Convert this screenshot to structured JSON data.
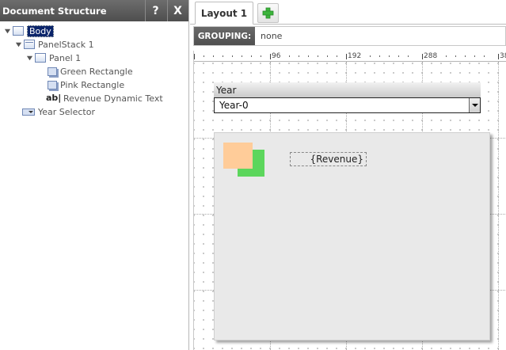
{
  "left_panel": {
    "title": "Document Structure",
    "help_label": "?",
    "close_label": "X",
    "tree": [
      {
        "label": "Body",
        "icon": "box-icon",
        "expanded": true,
        "selected": true
      },
      {
        "label": "PanelStack 1",
        "icon": "panelstack-icon",
        "expanded": true
      },
      {
        "label": "Panel 1",
        "icon": "panel-icon",
        "expanded": true
      },
      {
        "label": "Green Rectangle",
        "icon": "rectangle-icon"
      },
      {
        "label": "Pink Rectangle",
        "icon": "rectangle-icon"
      },
      {
        "label": "Revenue Dynamic Text",
        "icon": "text-icon",
        "icon_text": "ab|"
      },
      {
        "label": "Year Selector",
        "icon": "selector-icon"
      }
    ]
  },
  "tabs": {
    "layout_label": "Layout 1",
    "add_icon": "plus-icon"
  },
  "grouping": {
    "label": "GROUPING:",
    "value": "none"
  },
  "ruler": {
    "marks": [
      "96",
      "192",
      "288",
      "38"
    ]
  },
  "canvas": {
    "year_selector": {
      "header": "Year",
      "selected": "Year-0"
    },
    "revenue_placeholder": "{Revenue}"
  },
  "colors": {
    "header_bg": "#5a5a5a",
    "selection": "#0a246a",
    "green_rect": "#5cd65c",
    "pink_rect": "#ffcc99",
    "panel_bg": "#e9e9e9"
  }
}
